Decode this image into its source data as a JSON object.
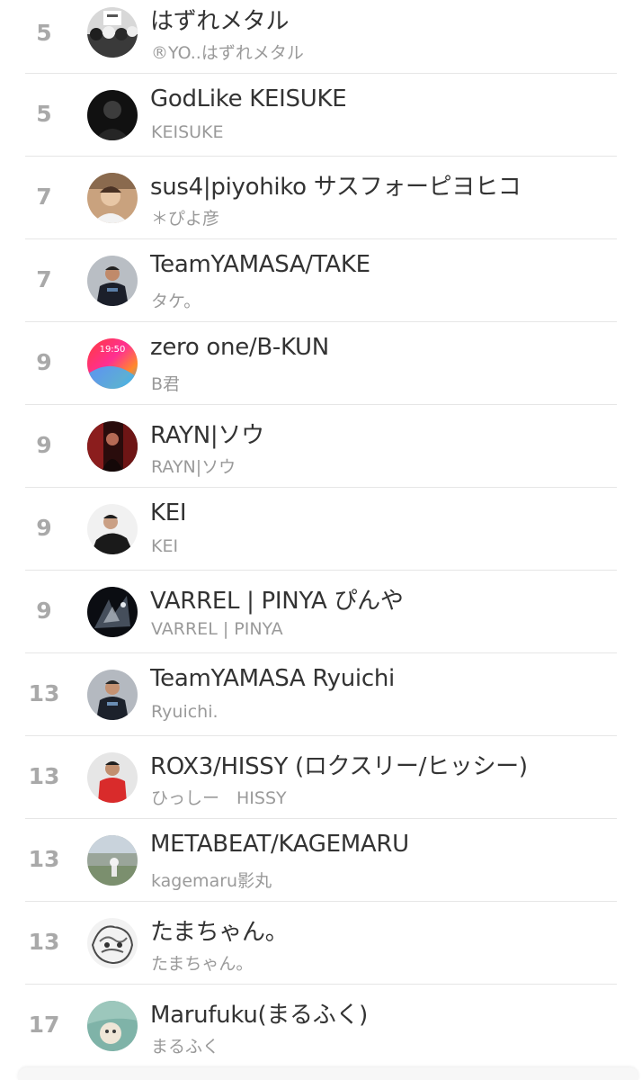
{
  "ranking": {
    "entries": [
      {
        "rank": "5",
        "name": "はずれメタル",
        "sub": "®YO..はずれメタル",
        "avatar": "bw-crowd-avatar"
      },
      {
        "rank": "5",
        "name": "GodLike KEISUKE",
        "sub": "KEISUKE",
        "avatar": "dark-portrait-avatar"
      },
      {
        "rank": "7",
        "name": "sus4|piyohiko サスフォーピヨヒコ",
        "sub": "＊ぴよ彦",
        "avatar": "warm-portrait-avatar"
      },
      {
        "rank": "7",
        "name": "TeamYAMASA/TAKE",
        "sub": "タケ。",
        "avatar": "gray-portrait-avatar"
      },
      {
        "rank": "9",
        "name": "zero one/B-KUN",
        "sub": "B君",
        "avatar": "gradient-clock-avatar"
      },
      {
        "rank": "9",
        "name": "RAYN|ソウ",
        "sub": "RAYN|ソウ",
        "avatar": "red-stage-avatar"
      },
      {
        "rank": "9",
        "name": "KEI",
        "sub": "KEI",
        "avatar": "light-portrait-avatar"
      },
      {
        "rank": "9",
        "name": "VARREL | PINYA ぴんや",
        "sub": "VARREL | PINYA",
        "avatar": "dark-splash-avatar"
      },
      {
        "rank": "13",
        "name": "TeamYAMASA Ryuichi",
        "sub": "Ryuichi.",
        "avatar": "gray-portrait-avatar"
      },
      {
        "rank": "13",
        "name": "ROX3/HISSY (ロクスリー/ヒッシー)",
        "sub": "ひっしー　HISSY",
        "avatar": "red-shirt-avatar"
      },
      {
        "rank": "13",
        "name": "METABEAT/KAGEMARU",
        "sub": "kagemaru影丸",
        "avatar": "outdoor-avatar"
      },
      {
        "rank": "13",
        "name": "たまちゃん。",
        "sub": "たまちゃん。",
        "avatar": "sketch-avatar"
      },
      {
        "rank": "17",
        "name": "Marufuku(まるふく)",
        "sub": "まるふく",
        "avatar": "teal-illustration-avatar"
      }
    ]
  }
}
